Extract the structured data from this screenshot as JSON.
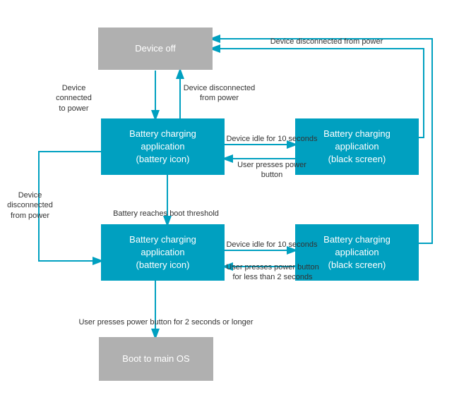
{
  "boxes": {
    "device_off": {
      "label": "Device off"
    },
    "battery_charging_top_left": {
      "label": "Battery charging\napplication\n(battery icon)"
    },
    "battery_charging_top_right": {
      "label": "Battery charging\napplication\n(black screen)"
    },
    "battery_charging_bottom_left": {
      "label": "Battery charging\napplication\n(battery icon)"
    },
    "battery_charging_bottom_right": {
      "label": "Battery charging\napplication\n(black screen)"
    },
    "boot_to_main_os": {
      "label": "Boot to main OS"
    }
  },
  "labels": {
    "connected_to_power": "Device connected\nto power",
    "disconnected_top": "Device disconnected\nfrom power",
    "disconnected_right": "Device disconnected from power",
    "idle_10s_top": "Device idle for 10 seconds",
    "user_power_top": "User presses power button",
    "battery_threshold": "Battery reaches boot threshold",
    "disconnected_left": "Device disconnected\nfrom power",
    "idle_10s_bottom": "Device idle for 10 seconds",
    "user_power_bottom": "User presses power button\nfor less than 2 seconds",
    "power_2s": "User presses power button for 2 seconds or longer"
  }
}
